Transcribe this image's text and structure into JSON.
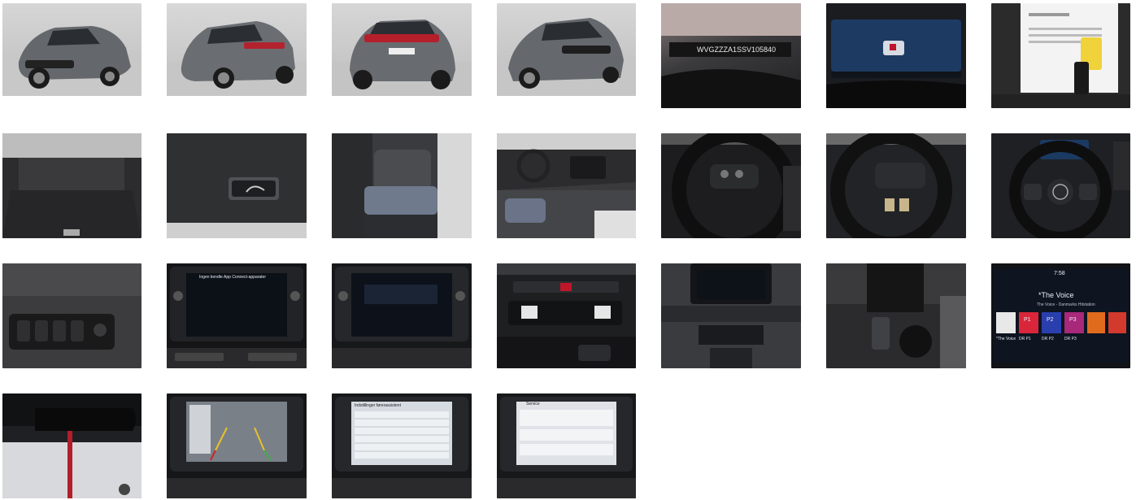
{
  "gallery": {
    "photos": [
      {
        "id": "p1",
        "subject": "front-three-quarter-exterior",
        "kind": "exterior"
      },
      {
        "id": "p2",
        "subject": "rear-three-quarter-exterior",
        "kind": "exterior"
      },
      {
        "id": "p3",
        "subject": "rear-exterior",
        "kind": "exterior"
      },
      {
        "id": "p4",
        "subject": "front-exterior",
        "kind": "exterior"
      },
      {
        "id": "p5",
        "subject": "vin-plate",
        "kind": "detail"
      },
      {
        "id": "p6",
        "subject": "digital-cockpit",
        "kind": "detail"
      },
      {
        "id": "p7",
        "subject": "documents-and-keys",
        "kind": "detail"
      },
      {
        "id": "p8",
        "subject": "trunk",
        "kind": "interior"
      },
      {
        "id": "p9",
        "subject": "tailgate-button",
        "kind": "detail"
      },
      {
        "id": "p10",
        "subject": "rear-seats",
        "kind": "interior"
      },
      {
        "id": "p11",
        "subject": "dashboard-passenger-view",
        "kind": "interior"
      },
      {
        "id": "p12",
        "subject": "steering-wheel-buttons-left",
        "kind": "interior"
      },
      {
        "id": "p13",
        "subject": "steering-wheel-buttons-right",
        "kind": "interior"
      },
      {
        "id": "p14",
        "subject": "steering-wheel",
        "kind": "interior"
      },
      {
        "id": "p15",
        "subject": "window-switches",
        "kind": "detail"
      },
      {
        "id": "p16",
        "subject": "infotainment-app-connect",
        "kind": "screen"
      },
      {
        "id": "p17",
        "subject": "infotainment-message",
        "kind": "screen"
      },
      {
        "id": "p18",
        "subject": "climate-panel",
        "kind": "detail"
      },
      {
        "id": "p19",
        "subject": "center-console",
        "kind": "interior"
      },
      {
        "id": "p20",
        "subject": "cupholders",
        "kind": "detail"
      },
      {
        "id": "p21",
        "subject": "infotainment-radio",
        "kind": "screen"
      },
      {
        "id": "p22",
        "subject": "rearview-mirror",
        "kind": "interior"
      },
      {
        "id": "p23",
        "subject": "rear-camera",
        "kind": "screen"
      },
      {
        "id": "p24",
        "subject": "infotainment-settings-list",
        "kind": "screen"
      },
      {
        "id": "p25",
        "subject": "infotainment-service",
        "kind": "screen"
      }
    ],
    "texts": {
      "vin": "WVGZZZA1SSV105840",
      "app_connect_title": "Ingen kendte App Connect-apparater",
      "radio_title": "*The Voice",
      "radio_sub": "The Voice - Danmarks Hitstation",
      "radio_time": "7:58",
      "radio_station_short": "*The Voice",
      "service_title": "Service",
      "settings_title": "Indstillinger førerassistent",
      "presets": [
        "P1",
        "P2",
        "P3"
      ],
      "preset_labels": [
        "DR P1",
        "DR P2",
        "DR P3"
      ]
    },
    "colors": {
      "car_gray": "#6b6f73",
      "studio_bg": "#cfcfcf",
      "screen_blue": "#1c3a66",
      "screen_dark": "#0d1118",
      "interior_dark": "#2a2a2c"
    }
  }
}
